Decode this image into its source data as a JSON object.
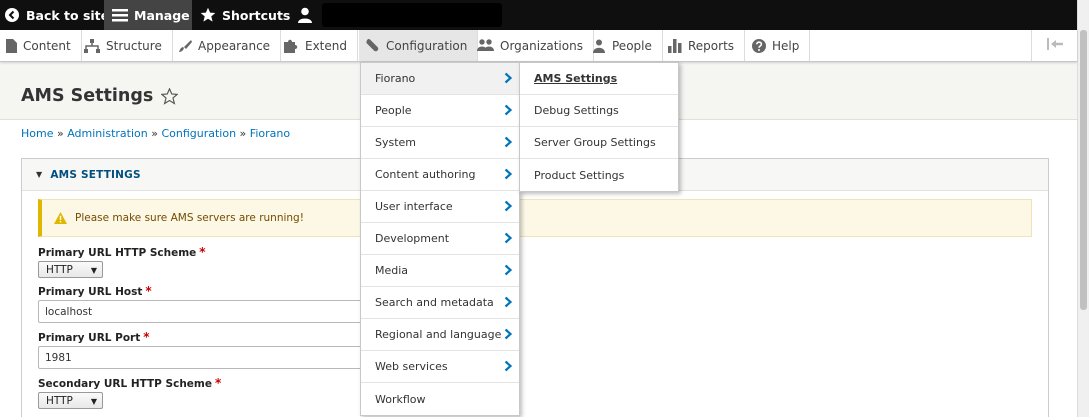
{
  "toolbar": {
    "back_label": "Back to site",
    "manage_label": "Manage",
    "shortcuts_label": "Shortcuts"
  },
  "tray": {
    "items": [
      {
        "label": "Content",
        "icon": "file-icon"
      },
      {
        "label": "Structure",
        "icon": "structure-icon"
      },
      {
        "label": "Appearance",
        "icon": "brush-icon"
      },
      {
        "label": "Extend",
        "icon": "puzzle-icon"
      },
      {
        "label": "Configuration",
        "icon": "wrench-icon"
      },
      {
        "label": "Organizations",
        "icon": "group-icon"
      },
      {
        "label": "People",
        "icon": "person-icon"
      },
      {
        "label": "Reports",
        "icon": "bar-chart-icon"
      },
      {
        "label": "Help",
        "icon": "help-icon"
      }
    ]
  },
  "page": {
    "title": "AMS Settings"
  },
  "breadcrumb": {
    "items": [
      "Home",
      "Administration",
      "Configuration",
      "Fiorano"
    ],
    "separator": " » "
  },
  "panel": {
    "summary": "AMS SETTINGS",
    "warning": "Please make sure AMS servers are running!",
    "fields": [
      {
        "label": "Primary URL HTTP Scheme",
        "type": "select",
        "value": "HTTP"
      },
      {
        "label": "Primary URL Host",
        "type": "text",
        "value": "localhost"
      },
      {
        "label": "Primary URL Port",
        "type": "text",
        "value": "1981"
      },
      {
        "label": "Secondary URL HTTP Scheme",
        "type": "select",
        "value": "HTTP"
      }
    ]
  },
  "menu_level1": {
    "items": [
      "Fiorano",
      "People",
      "System",
      "Content authoring",
      "User interface",
      "Development",
      "Media",
      "Search and metadata",
      "Regional and language",
      "Web services",
      "Workflow"
    ]
  },
  "menu_level2": {
    "items": [
      "AMS Settings",
      "Debug Settings",
      "Server Group Settings",
      "Product Settings"
    ]
  },
  "colors": {
    "toolbar_bg": "#0f0f0f",
    "link": "#0074bd",
    "required": "#cc0000",
    "warning_border": "#e0b700"
  }
}
